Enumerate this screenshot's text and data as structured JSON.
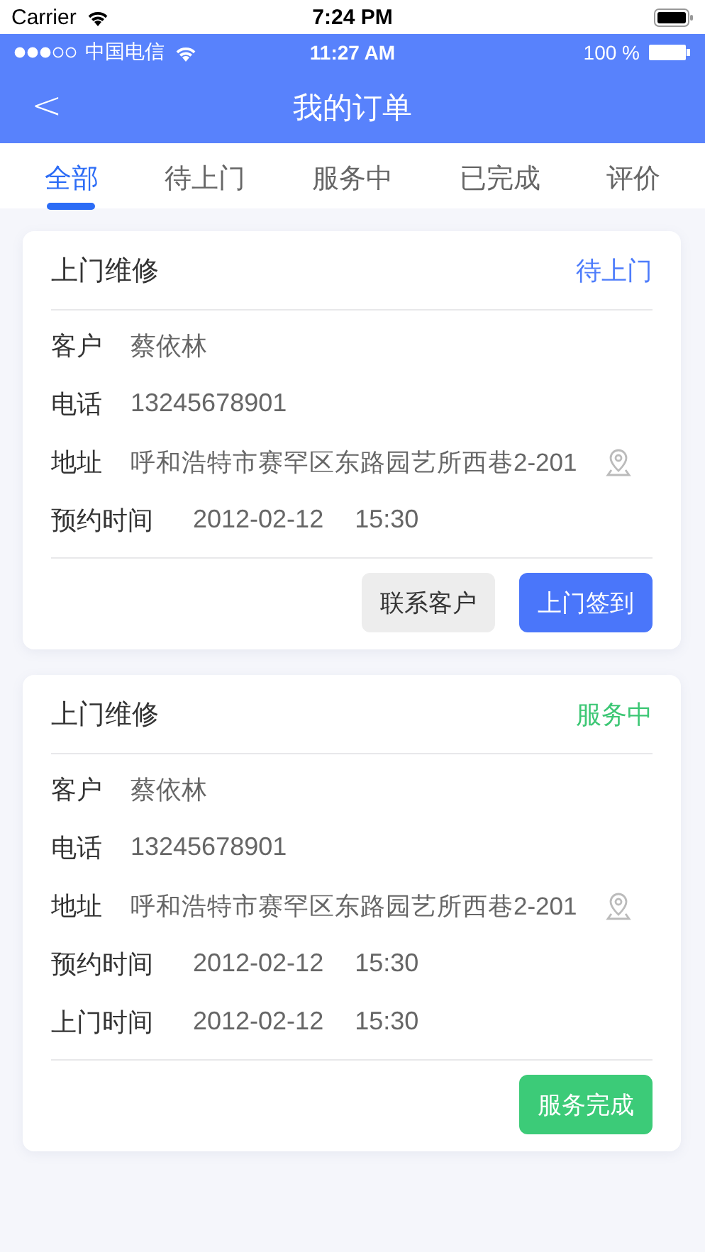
{
  "device_status": {
    "carrier": "Carrier",
    "time": "7:24 PM"
  },
  "app_status": {
    "carrier": "中国电信",
    "time": "11:27 AM",
    "battery": "100 %"
  },
  "nav": {
    "back": "<",
    "title": "我的订单"
  },
  "tabs": [
    {
      "label": "全部",
      "selected": true
    },
    {
      "label": "待上门",
      "selected": false
    },
    {
      "label": "服务中",
      "selected": false
    },
    {
      "label": "已完成",
      "selected": false
    },
    {
      "label": "评价",
      "selected": false
    }
  ],
  "orders": [
    {
      "service": "上门维修",
      "status": {
        "text": "待上门",
        "kind": "pending"
      },
      "fields": [
        {
          "kind": "text",
          "label": "客户",
          "value": "蔡依林"
        },
        {
          "kind": "text",
          "label": "电话",
          "value": "13245678901"
        },
        {
          "kind": "address",
          "label": "地址",
          "value": "呼和浩特市赛罕区东路园艺所西巷2-201"
        },
        {
          "kind": "datetime",
          "label": "预约时间",
          "date": "2012-02-12",
          "time": "15:30"
        }
      ],
      "buttons": [
        {
          "label": "联系客户",
          "kind": "secondary"
        },
        {
          "label": "上门签到",
          "kind": "primary"
        }
      ]
    },
    {
      "service": "上门维修",
      "status": {
        "text": "服务中",
        "kind": "in_service"
      },
      "fields": [
        {
          "kind": "text",
          "label": "客户",
          "value": "蔡依林"
        },
        {
          "kind": "text",
          "label": "电话",
          "value": "13245678901"
        },
        {
          "kind": "address",
          "label": "地址",
          "value": "呼和浩特市赛罕区东路园艺所西巷2-201"
        },
        {
          "kind": "datetime",
          "label": "预约时间",
          "date": "2012-02-12",
          "time": "15:30"
        },
        {
          "kind": "datetime",
          "label": "上门时间",
          "date": "2012-02-12",
          "time": "15:30"
        }
      ],
      "buttons": [
        {
          "label": "服务完成",
          "kind": "success"
        }
      ]
    }
  ]
}
